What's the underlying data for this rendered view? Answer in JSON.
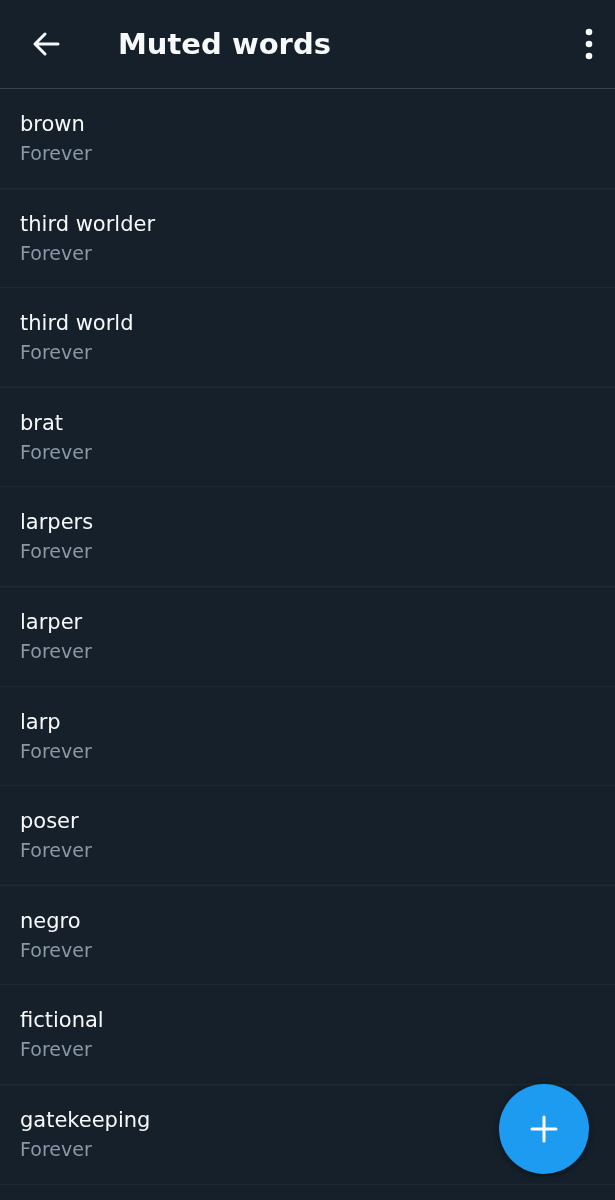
{
  "header": {
    "title": "Muted words"
  },
  "muted_words": [
    {
      "word": "brown",
      "duration": "Forever"
    },
    {
      "word": "third worlder",
      "duration": "Forever"
    },
    {
      "word": "third world",
      "duration": "Forever"
    },
    {
      "word": "brat",
      "duration": "Forever"
    },
    {
      "word": "larpers",
      "duration": "Forever"
    },
    {
      "word": "larper",
      "duration": "Forever"
    },
    {
      "word": "larp",
      "duration": "Forever"
    },
    {
      "word": "poser",
      "duration": "Forever"
    },
    {
      "word": "negro",
      "duration": "Forever"
    },
    {
      "word": "fictional",
      "duration": "Forever"
    },
    {
      "word": "gatekeeping",
      "duration": "Forever"
    }
  ]
}
